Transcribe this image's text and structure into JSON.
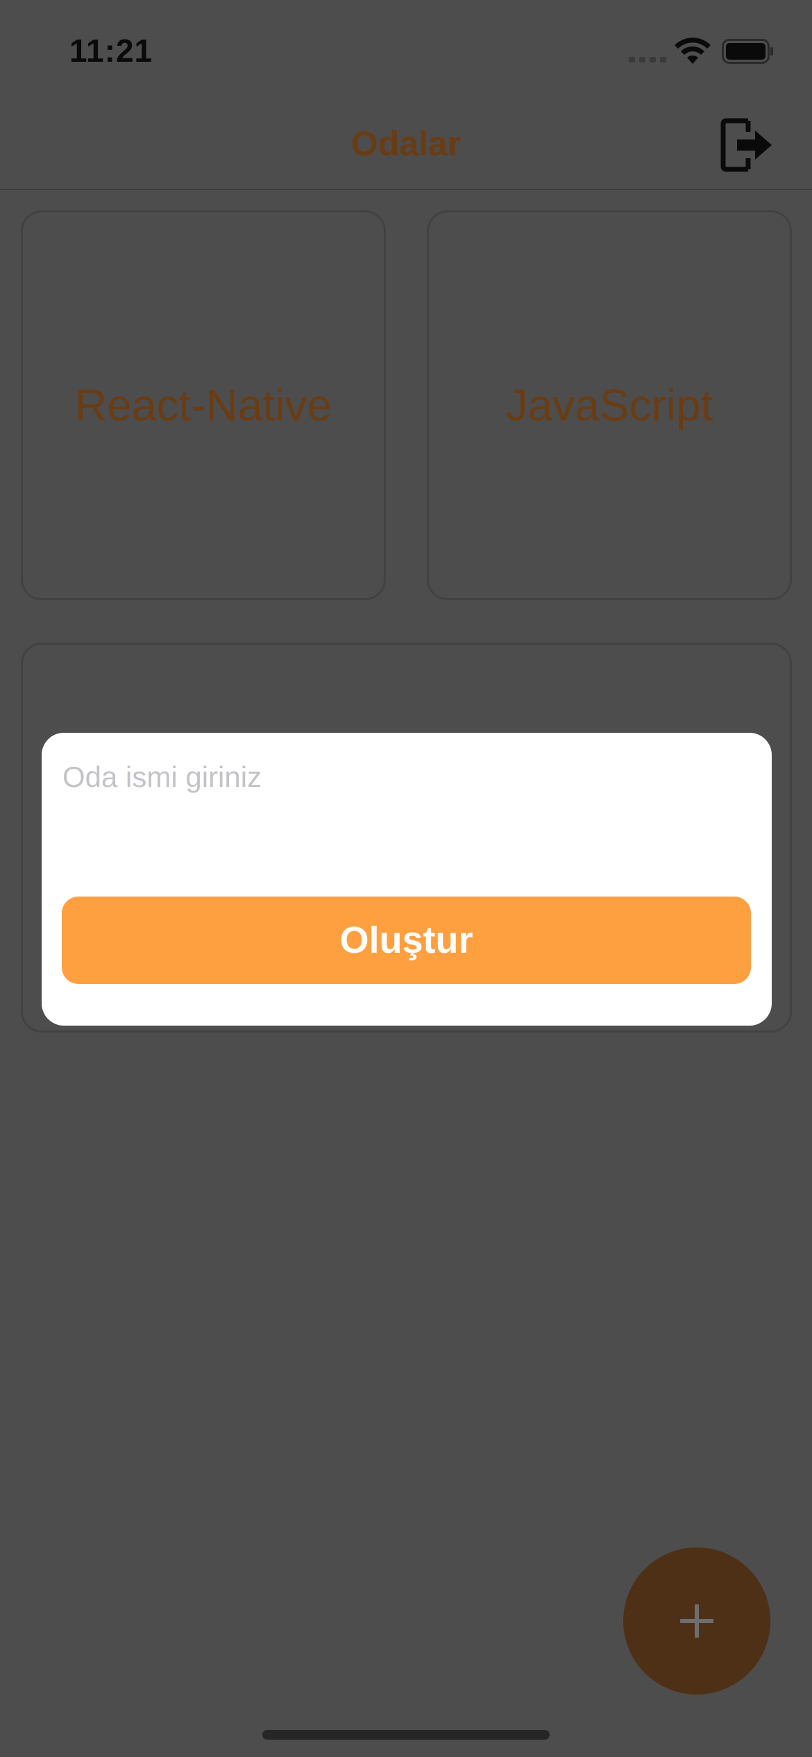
{
  "status_bar": {
    "time": "11:21",
    "icons": [
      "cellular-signal-icon",
      "wifi-icon",
      "battery-icon"
    ]
  },
  "header": {
    "title": "Odalar",
    "logout_icon": "logout-icon"
  },
  "rooms": [
    {
      "name": "React-Native"
    },
    {
      "name": "JavaScript"
    },
    {
      "name": ""
    }
  ],
  "modal": {
    "input_placeholder": "Oda ismi giriniz",
    "input_value": "",
    "button_label": "Oluştur"
  },
  "fab": {
    "icon": "plus-icon"
  },
  "colors": {
    "overlay_background": "#4d4d4d",
    "accent_orange": "#ffa040",
    "dimmed_accent": "#6a3c14",
    "fab_dimmed": "#4e3016",
    "modal_background": "#ffffff"
  }
}
